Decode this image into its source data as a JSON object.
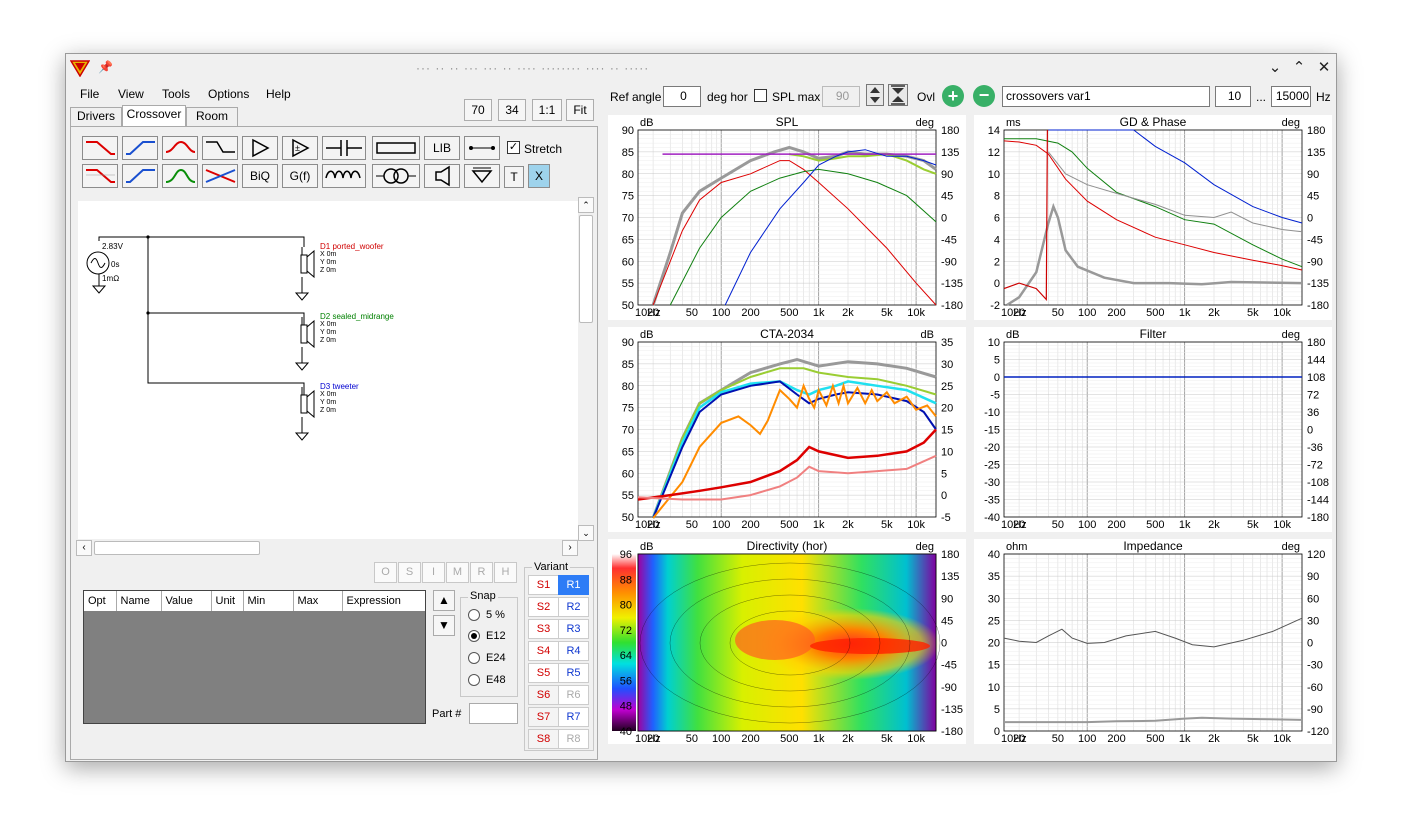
{
  "title": "··· ·· ·· ··· ··· ·· ···· ········ ···· ·· ·····",
  "menu": [
    {
      "label": "File"
    },
    {
      "label": "View"
    },
    {
      "label": "Tools"
    },
    {
      "label": "Options"
    },
    {
      "label": "Help"
    }
  ],
  "tabs": [
    {
      "label": "Drivers"
    },
    {
      "label": "Crossover"
    },
    {
      "label": "Room"
    }
  ],
  "zoom_buttons": [
    "70",
    "34",
    "1:1",
    "Fit"
  ],
  "palette": {
    "lib": "LIB",
    "biq": "BiQ",
    "gf": "G(f)",
    "t": "T",
    "x": "X",
    "stretch": "Stretch"
  },
  "schematic": {
    "source": {
      "v": "2.83V",
      "t": "0s",
      "r": "1mΩ"
    },
    "drivers": [
      {
        "name": "D1 ported_woofer",
        "x": "X 0m",
        "y": "Y 0m",
        "z": "Z 0m",
        "color": "#d00000"
      },
      {
        "name": "D2 sealed_midrange",
        "x": "X 0m",
        "y": "Y 0m",
        "z": "Z 0m",
        "color": "#008000"
      },
      {
        "name": "D3 tweeter",
        "x": "X 0m",
        "y": "Y 0m",
        "z": "Z 0m",
        "color": "#0000d0"
      }
    ]
  },
  "tool_buttons": [
    "O",
    "S",
    "I",
    "M",
    "R",
    "H"
  ],
  "table_headers": [
    "Opt",
    "Name",
    "Value",
    "Unit",
    "Min",
    "Max",
    "Expression"
  ],
  "snap": {
    "title": "Snap",
    "options": [
      "5 %",
      "E12",
      "E24",
      "E48"
    ],
    "selected": "E12"
  },
  "part_label": "Part #",
  "variant": {
    "title": "Variant",
    "s": [
      "S1",
      "S2",
      "S3",
      "S4",
      "S5",
      "S6",
      "S7",
      "S8"
    ],
    "r": [
      "R1",
      "R2",
      "R3",
      "R4",
      "R5",
      "R6",
      "R7",
      "R8"
    ]
  },
  "toolbar": {
    "ref_angle_label": "Ref angle",
    "ref_angle": "0",
    "deg_hor": "deg hor",
    "spl_max": "SPL max",
    "spl_max_value": "90",
    "ovl": "Ovl",
    "name": "crossovers var1",
    "f_lo": "10",
    "dots": "...",
    "f_hi": "15000",
    "hz": "Hz"
  },
  "plots": {
    "spl": {
      "title": "SPL",
      "ylabel": "dB",
      "y2label": "deg",
      "yticks": [
        "90",
        "85",
        "80",
        "75",
        "70",
        "65",
        "60",
        "55",
        "50"
      ],
      "y2ticks": [
        "180",
        "135",
        "90",
        "45",
        "0",
        "-45",
        "-90",
        "-135",
        "-180"
      ]
    },
    "gd": {
      "title": "GD & Phase",
      "ylabel": "ms",
      "y2label": "deg",
      "yticks": [
        "14",
        "12",
        "10",
        "8",
        "6",
        "4",
        "2",
        "0",
        "-2"
      ],
      "y2ticks": [
        "180",
        "135",
        "90",
        "45",
        "0",
        "-45",
        "-90",
        "-135",
        "-180"
      ]
    },
    "cta": {
      "title": "CTA-2034",
      "ylabel": "dB",
      "y2label": "dB",
      "yticks": [
        "90",
        "85",
        "80",
        "75",
        "70",
        "65",
        "60",
        "55",
        "50"
      ],
      "y2ticks": [
        "35",
        "30",
        "25",
        "20",
        "15",
        "10",
        "5",
        "0",
        "-5"
      ]
    },
    "filter": {
      "title": "Filter",
      "ylabel": "dB",
      "y2label": "deg",
      "yticks": [
        "10",
        "5",
        "0",
        "-5",
        "-10",
        "-15",
        "-20",
        "-25",
        "-30",
        "-35",
        "-40"
      ],
      "y2ticks": [
        "180",
        "144",
        "108",
        "72",
        "36",
        "0",
        "-36",
        "-72",
        "-108",
        "-144",
        "-180"
      ]
    },
    "dir": {
      "title": "Directivity (hor)",
      "ylabel": "dB",
      "y2label": "deg",
      "cticks": [
        "96",
        "88",
        "80",
        "72",
        "64",
        "56",
        "48",
        "40"
      ],
      "y2ticks": [
        "180",
        "135",
        "90",
        "45",
        "0",
        "-45",
        "-90",
        "-135",
        "-180"
      ]
    },
    "imp": {
      "title": "Impedance",
      "ylabel": "ohm",
      "y2label": "deg",
      "yticks": [
        "40",
        "35",
        "30",
        "25",
        "20",
        "15",
        "10",
        "5",
        "0"
      ],
      "y2ticks": [
        "120",
        "90",
        "60",
        "30",
        "0",
        "-30",
        "-60",
        "-90",
        "-120"
      ]
    },
    "xticks": [
      "10Hz",
      "20",
      "50",
      "100",
      "200",
      "500",
      "1k",
      "2k",
      "5k",
      "10k"
    ]
  }
}
